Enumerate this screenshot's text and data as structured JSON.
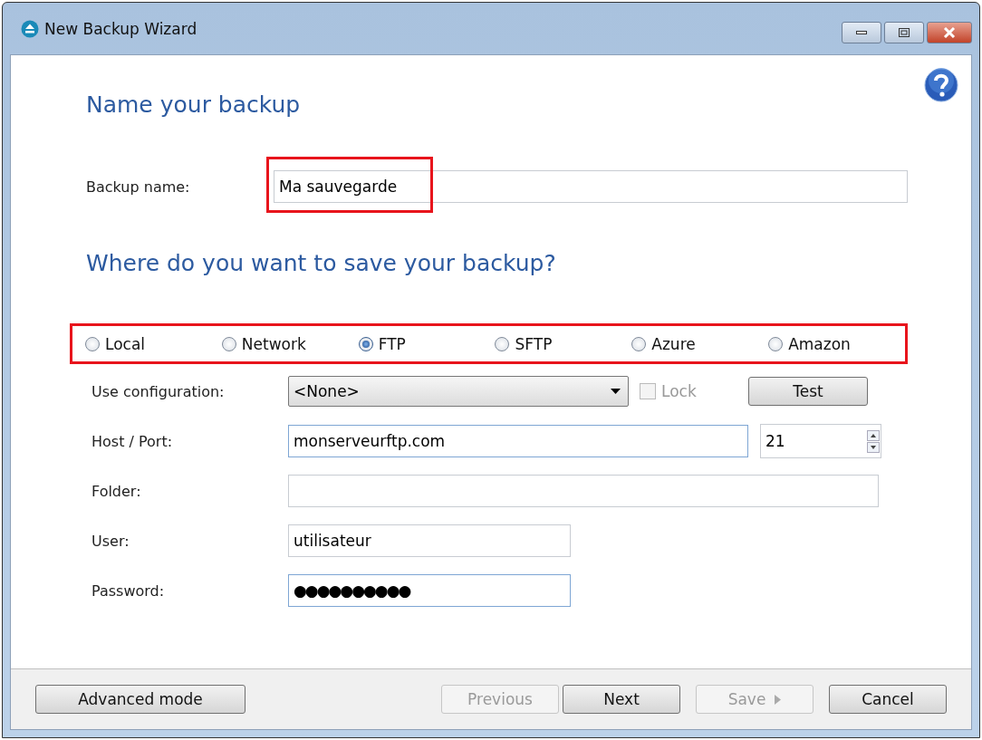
{
  "window": {
    "title": "New Backup Wizard"
  },
  "heading_name": "Name your backup",
  "backup_name": {
    "label": "Backup name:",
    "value": "Ma sauvegarde",
    "highlight": true
  },
  "heading_destination": "Where do you want to save your backup?",
  "destinations": {
    "highlight": true,
    "options": [
      {
        "label": "Local",
        "selected": false
      },
      {
        "label": "Network",
        "selected": false
      },
      {
        "label": "FTP",
        "selected": true
      },
      {
        "label": "SFTP",
        "selected": false
      },
      {
        "label": "Azure",
        "selected": false
      },
      {
        "label": "Amazon",
        "selected": false
      }
    ]
  },
  "configuration": {
    "label": "Use configuration:",
    "value": "<None>",
    "lock_label": "Lock",
    "lock_checked": false,
    "lock_disabled": true,
    "test_button": "Test"
  },
  "host": {
    "label": "Host / Port:",
    "value": "monserveurftp.com",
    "port": "21"
  },
  "folder": {
    "label": "Folder:"
  },
  "user": {
    "label": "User:",
    "value": "utilisateur"
  },
  "password": {
    "label": "Password:",
    "value": "●●●●●●●●●●"
  },
  "buttons": [
    {
      "label": "Advanced mode",
      "disabled": false,
      "kind": "plain"
    },
    {
      "label": "Previous",
      "disabled": true,
      "kind": "plain"
    },
    {
      "label": "Next",
      "disabled": false,
      "kind": "plain"
    },
    {
      "label": "Save",
      "disabled": true,
      "kind": "arrow"
    },
    {
      "label": "Cancel",
      "disabled": false,
      "kind": "plain"
    }
  ]
}
